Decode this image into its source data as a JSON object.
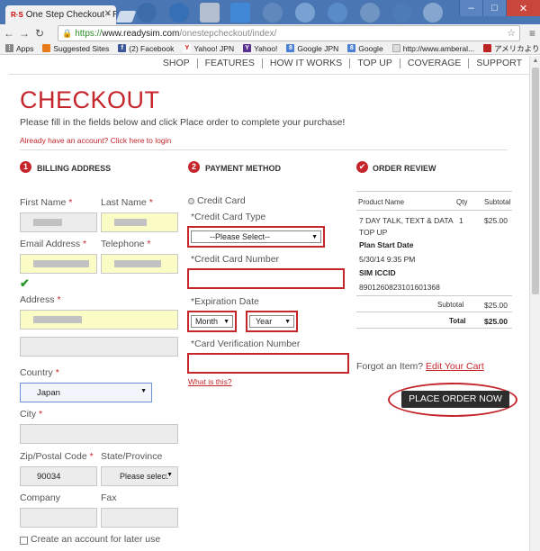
{
  "browser": {
    "tab_title": "One Step Checkout - Rea",
    "tab_favicon": "R·S",
    "url_scheme": "https://",
    "url_host": "www.readysim.com",
    "url_path": "/onestepcheckout/index/",
    "bookmarks": [
      "Apps",
      "Suggested Sites",
      "(2) Facebook",
      "Yahoo! JPN",
      "Yahoo!",
      "Google JPN",
      "Google",
      "http://www.amberal...",
      "アメリカより（携..."
    ]
  },
  "nav": {
    "items": [
      "SHOP",
      "FEATURES",
      "HOW IT WORKS",
      "TOP UP",
      "COVERAGE",
      "SUPPORT"
    ]
  },
  "checkout": {
    "title": "CHECKOUT",
    "intro": "Please fill in the fields below and click Place order to complete your purchase!",
    "login_link": "Already have an account? Click here to login"
  },
  "billing": {
    "step": "1",
    "heading": "BILLING ADDRESS",
    "first_name": "First Name",
    "last_name": "Last Name",
    "email": "Email Address",
    "telephone": "Telephone",
    "address": "Address",
    "country": "Country",
    "country_value": "Japan",
    "city": "City",
    "zip": "Zip/Postal Code",
    "zip_value": "90034",
    "state": "State/Province",
    "state_value": "Please select",
    "company": "Company",
    "fax": "Fax",
    "create_account": "Create an account for later use",
    "required_mark": "*"
  },
  "payment": {
    "step": "2",
    "heading": "PAYMENT METHOD",
    "method": "Credit Card",
    "card_type_label": "*Credit Card Type",
    "card_type_value": "--Please Select--",
    "card_number_label": "*Credit Card Number",
    "exp_label": "*Expiration Date",
    "month": "Month",
    "year": "Year",
    "cvv_label": "*Card Verification Number",
    "whats_this": "What is this?"
  },
  "review": {
    "heading": "ORDER REVIEW",
    "col_product": "Product Name",
    "col_qty": "Qty",
    "col_subtotal": "Subtotal",
    "item_name_1": "7 DAY TALK, TEXT & DATA",
    "item_name_2": "TOP UP",
    "item_qty": "1",
    "item_price": "$25.00",
    "plan_start_label": "Plan Start Date",
    "plan_start_value": "5/30/14 9:35 PM",
    "sim_label": "SIM ICCID",
    "sim_value": "8901260823101601368",
    "subtotal_label": "Subtotal",
    "subtotal_value": "$25.00",
    "total_label": "Total",
    "total_value": "$25.00",
    "forgot": "Forgot an Item?",
    "edit_cart": "Edit Your Cart",
    "place_order": "PLACE ORDER NOW"
  },
  "colors": {
    "accent": "#c5262c",
    "highlight_field": "#fbfbc5",
    "button": "#2d2d2d"
  }
}
